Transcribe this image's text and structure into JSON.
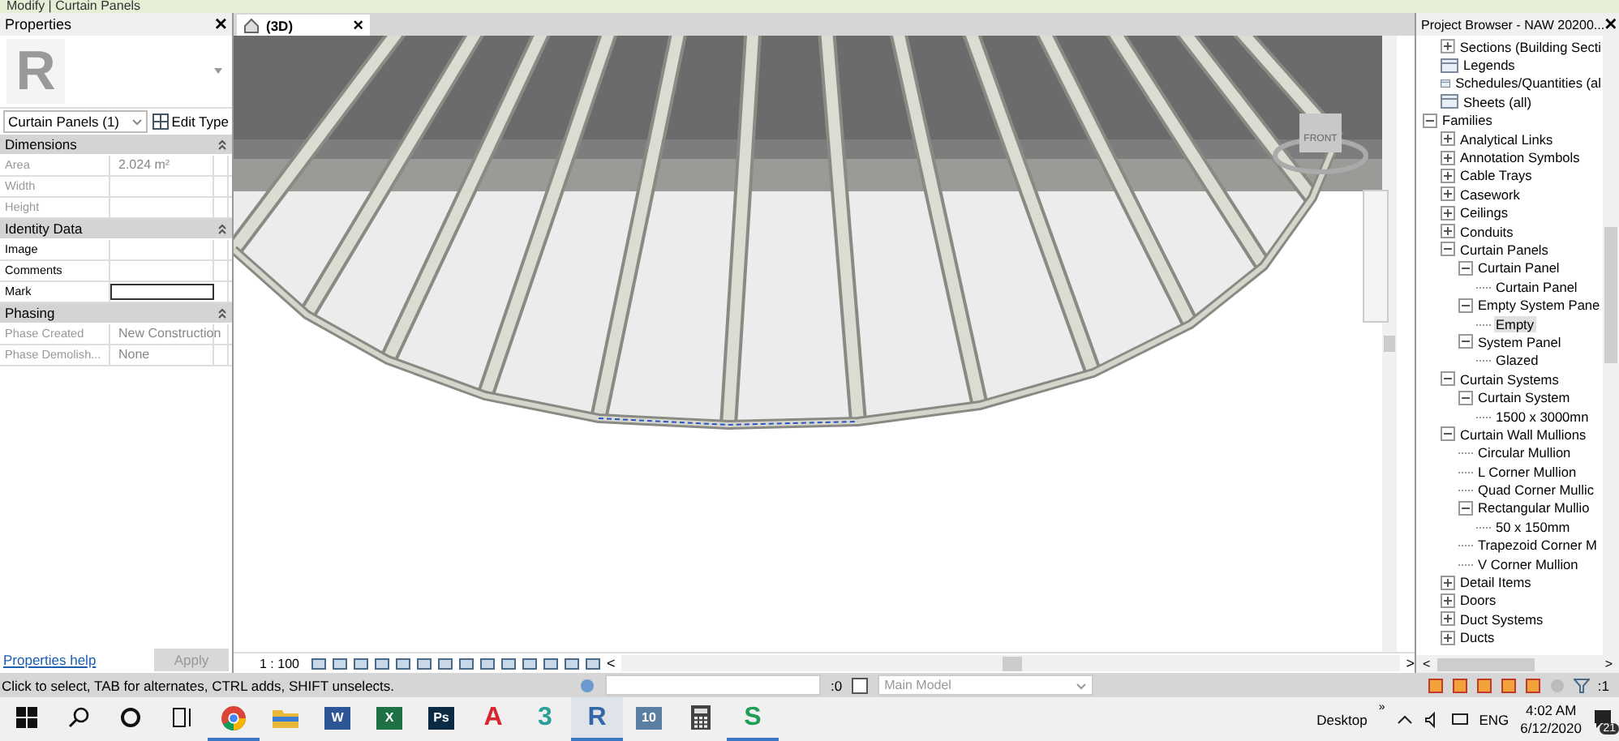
{
  "ribbon_context": "Modify | Curtain Panels",
  "properties": {
    "title": "Properties",
    "close": "×",
    "type_glyph": "R",
    "type_selector": "Curtain Panels (1)",
    "edit_type": "Edit Type",
    "groups": [
      {
        "name": "Dimensions",
        "rows": [
          {
            "label": "Area",
            "value": "2.024 m²",
            "readonly": true,
            "active": false
          },
          {
            "label": "Width",
            "value": "",
            "readonly": true,
            "active": false
          },
          {
            "label": "Height",
            "value": "",
            "readonly": true,
            "active": false
          }
        ]
      },
      {
        "name": "Identity Data",
        "rows": [
          {
            "label": "Image",
            "value": "",
            "readonly": false,
            "active": false
          },
          {
            "label": "Comments",
            "value": "",
            "readonly": false,
            "active": false
          },
          {
            "label": "Mark",
            "value": "",
            "readonly": false,
            "active": true
          }
        ]
      },
      {
        "name": "Phasing",
        "rows": [
          {
            "label": "Phase Created",
            "value": "New Construction",
            "readonly": true,
            "active": false
          },
          {
            "label": "Phase Demolish...",
            "value": "None",
            "readonly": true,
            "active": false
          }
        ]
      }
    ],
    "help_link": "Properties help",
    "apply": {
      "label": "Apply",
      "disabled": true
    }
  },
  "view": {
    "tab": {
      "label": "(3D)",
      "close": "×"
    },
    "scale": "1 : 100",
    "view_cube_label": "FRONT",
    "scroll_left": "<",
    "scroll_right": ">"
  },
  "project_browser": {
    "title": "Project Browser - NAW 20200...",
    "close": "×",
    "views_tail": [
      {
        "label": "Sections (Building Secti",
        "kind": "group",
        "expanded": false,
        "selected": false
      },
      {
        "label": "Legends",
        "kind": "view",
        "selected": false
      },
      {
        "label": "Schedules/Quantities (al",
        "kind": "view",
        "selected": false
      },
      {
        "label": "Sheets (all)",
        "kind": "view",
        "selected": false
      }
    ],
    "tree": [
      {
        "label": "Families",
        "kind": "group",
        "expanded": true,
        "selected": false,
        "children": [
          {
            "label": "Analytical Links",
            "kind": "group",
            "expanded": false,
            "selected": false
          },
          {
            "label": "Annotation Symbols",
            "kind": "group",
            "expanded": false,
            "selected": false
          },
          {
            "label": "Cable Trays",
            "kind": "group",
            "expanded": false,
            "selected": false
          },
          {
            "label": "Casework",
            "kind": "group",
            "expanded": false,
            "selected": false
          },
          {
            "label": "Ceilings",
            "kind": "group",
            "expanded": false,
            "selected": false
          },
          {
            "label": "Conduits",
            "kind": "group",
            "expanded": false,
            "selected": false
          },
          {
            "label": "Curtain Panels",
            "kind": "group",
            "expanded": true,
            "selected": false,
            "children": [
              {
                "label": "Curtain Panel",
                "kind": "group",
                "expanded": true,
                "selected": false,
                "children": [
                  {
                    "label": "Curtain Panel",
                    "kind": "leaf",
                    "selected": false
                  }
                ]
              },
              {
                "label": "Empty System Pane",
                "kind": "group",
                "expanded": true,
                "selected": false,
                "children": [
                  {
                    "label": "Empty",
                    "kind": "leaf",
                    "selected": true
                  }
                ]
              },
              {
                "label": "System Panel",
                "kind": "group",
                "expanded": true,
                "selected": false,
                "children": [
                  {
                    "label": "Glazed",
                    "kind": "leaf",
                    "selected": false
                  }
                ]
              }
            ]
          },
          {
            "label": "Curtain Systems",
            "kind": "group",
            "expanded": true,
            "selected": false,
            "children": [
              {
                "label": "Curtain System",
                "kind": "group",
                "expanded": true,
                "selected": false,
                "children": [
                  {
                    "label": "1500 x 3000mn",
                    "kind": "leaf",
                    "selected": false
                  }
                ]
              }
            ]
          },
          {
            "label": "Curtain Wall Mullions",
            "kind": "group",
            "expanded": true,
            "selected": false,
            "children": [
              {
                "label": "Circular Mullion",
                "kind": "leaf",
                "selected": false
              },
              {
                "label": "L Corner Mullion",
                "kind": "leaf",
                "selected": false
              },
              {
                "label": "Quad Corner Mullic",
                "kind": "leaf",
                "selected": false
              },
              {
                "label": "Rectangular Mullio",
                "kind": "group",
                "expanded": true,
                "selected": false,
                "children": [
                  {
                    "label": "50 x 150mm",
                    "kind": "leaf",
                    "selected": false
                  }
                ]
              },
              {
                "label": "Trapezoid Corner M",
                "kind": "leaf",
                "selected": false
              },
              {
                "label": "V Corner Mullion",
                "kind": "leaf",
                "selected": false
              }
            ]
          },
          {
            "label": "Detail Items",
            "kind": "group",
            "expanded": false,
            "selected": false
          },
          {
            "label": "Doors",
            "kind": "group",
            "expanded": false,
            "selected": false
          },
          {
            "label": "Duct Systems",
            "kind": "group",
            "expanded": false,
            "selected": false
          },
          {
            "label": "Ducts",
            "kind": "group",
            "expanded": false,
            "selected": false
          }
        ]
      }
    ],
    "scroll_left": "<",
    "scroll_right": ">"
  },
  "status_bar": {
    "message": "Click to select, TAB for alternates, CTRL adds, SHIFT unselects.",
    "editing_count": ":0",
    "design_option": "Main Model",
    "filter_count": ":1"
  },
  "taskbar": {
    "apps": [
      {
        "kind": "start",
        "running": false,
        "active": false
      },
      {
        "kind": "search",
        "running": false,
        "active": false
      },
      {
        "kind": "cortana",
        "running": false,
        "active": false
      },
      {
        "kind": "taskview",
        "running": false,
        "active": false
      },
      {
        "kind": "chrome",
        "running": true,
        "active": false
      },
      {
        "kind": "folder",
        "running": false,
        "active": false
      },
      {
        "kind": "tile",
        "glyph": "W",
        "color": "#2b5797",
        "running": false,
        "active": false
      },
      {
        "kind": "tile",
        "glyph": "X",
        "color": "#1e7145",
        "running": false,
        "active": false
      },
      {
        "kind": "tile",
        "glyph": "Ps",
        "color": "#0b2b44",
        "running": false,
        "active": false
      },
      {
        "kind": "letter",
        "glyph": "A",
        "color": "#d7262e",
        "running": false,
        "active": false
      },
      {
        "kind": "letter",
        "glyph": "3",
        "color": "#2aa198",
        "running": false,
        "active": false
      },
      {
        "kind": "letter",
        "glyph": "R",
        "color": "#3467a8",
        "running": true,
        "active": true
      },
      {
        "kind": "tile",
        "glyph": "10",
        "color": "#5b7fa3",
        "running": false,
        "active": false
      },
      {
        "kind": "calculator",
        "running": false,
        "active": false
      },
      {
        "kind": "letter",
        "glyph": "S",
        "color": "#1f9d55",
        "running": true,
        "active": false
      }
    ],
    "desktop": "Desktop",
    "more": "»",
    "language": "ENG",
    "time": "4:02 AM",
    "date": "6/12/2020",
    "notifications": "21"
  }
}
